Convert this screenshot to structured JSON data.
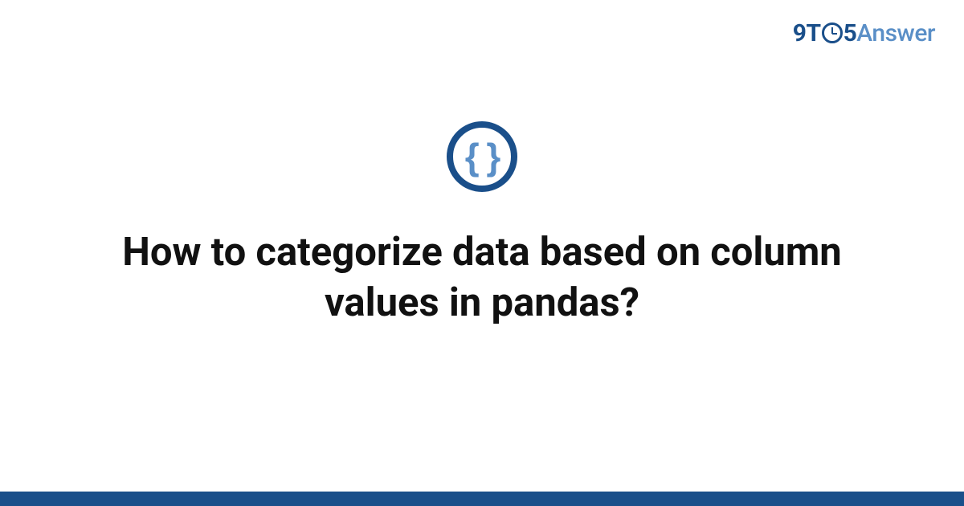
{
  "logo": {
    "part1": "9T",
    "part2": "5",
    "part3": "Answer"
  },
  "icon": {
    "symbol": "{ }"
  },
  "title": "How to categorize data based on column values in pandas?",
  "colors": {
    "primary": "#1a4f8a",
    "secondary": "#5a8fc7"
  }
}
